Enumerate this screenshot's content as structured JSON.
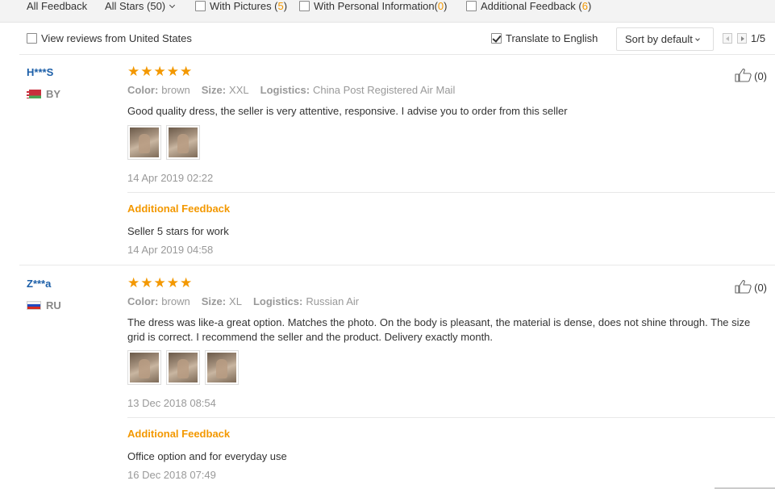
{
  "filter_bar": {
    "all_feedback": "All Feedback",
    "all_stars": "All Stars (50)",
    "with_pictures_label": "With Pictures (",
    "with_pictures_count": "5",
    "with_personal_label": "With Personal Information(",
    "with_personal_count": "0",
    "additional_label": "Additional Feedback (",
    "additional_count": "6",
    "close_paren": ")"
  },
  "options": {
    "view_us": "View reviews from United States",
    "view_us_checked": false,
    "translate": "Translate to English",
    "translate_checked": true,
    "sort": "Sort by default",
    "page": "1/5"
  },
  "reviews": [
    {
      "user": "H***S",
      "country": "BY",
      "rating": 5,
      "stars": "★★★★★",
      "color_label": "Color:",
      "color": "brown",
      "size_label": "Size:",
      "size": "XXL",
      "logistics_label": "Logistics:",
      "logistics": "China Post Registered Air Mail",
      "text": "Good quality dress, the seller is very attentive, responsive. I advise you to order from this seller",
      "photos": 2,
      "date": "14 Apr 2019 02:22",
      "additional_title": "Additional Feedback",
      "additional_text": "Seller 5 stars for work",
      "additional_date": "14 Apr 2019 04:58",
      "likes": "(0)"
    },
    {
      "user": "Z***a",
      "country": "RU",
      "rating": 5,
      "stars": "★★★★★",
      "color_label": "Color:",
      "color": "brown",
      "size_label": "Size:",
      "size": "XL",
      "logistics_label": "Logistics:",
      "logistics": "Russian Air",
      "text": "The dress was like-a great option. Matches the photo. On the body is pleasant, the material is dense, does not shine through. The size grid is correct. I recommend the seller and the product. Delivery exactly month.",
      "photos": 3,
      "date": "13 Dec 2018 08:54",
      "additional_title": "Additional Feedback",
      "additional_text": "Office option and for everyday use",
      "additional_date": "16 Dec 2018 07:49",
      "likes": "(0)"
    }
  ],
  "colors": {
    "accent": "#f39800",
    "username": "#1c5fa8",
    "muted": "#999999",
    "text": "#333333"
  },
  "icons": [
    "chevron-down-icon",
    "checkbox-icon",
    "thumbs-up-icon",
    "prev-page-icon",
    "next-page-icon",
    "flag-icon"
  ]
}
